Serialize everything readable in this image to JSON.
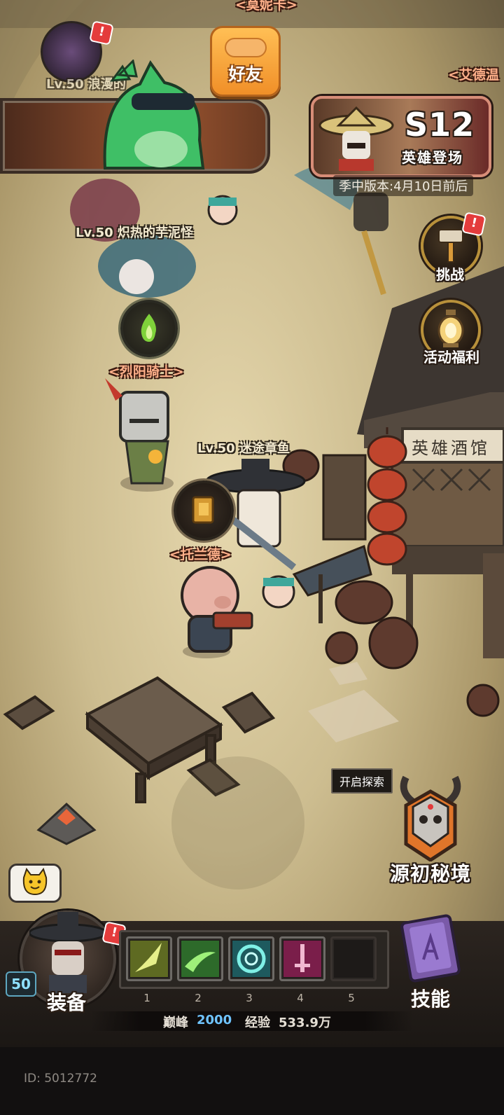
{
  "friends_button": {
    "label": "好友"
  },
  "season_banner": {
    "season": "S12",
    "subtitle": "英雄登场",
    "note": "季中版本:4月10日前后"
  },
  "side_buttons": [
    {
      "label": "挑战",
      "icon": "hammer-icon"
    },
    {
      "label": "活动福利",
      "icon": "lantern-icon"
    }
  ],
  "players": [
    {
      "name": "Lv.50 浪漫的"
    },
    {
      "name": "Lv.50 炽热的芋泥怪"
    },
    {
      "name": "Lv.50 迷途章鱼"
    }
  ],
  "npcs": [
    {
      "name": "<烈阳骑士>"
    },
    {
      "name": "<托兰德>"
    },
    {
      "name": "<艾德温"
    },
    {
      "name": "<莫妮卡>"
    }
  ],
  "tavern_sign": "英雄酒馆",
  "explore": {
    "tip": "开启探索",
    "label": "源初秘境"
  },
  "hud": {
    "level": "50",
    "equip_label": "装备",
    "skill_label": "技能",
    "slot_numbers": [
      "1",
      "2",
      "3",
      "4",
      "5"
    ],
    "peak_label": "巅峰",
    "peak_value": "2000",
    "exp_label": "经验",
    "exp_value": "533.9万",
    "player_id": "ID: 5012772"
  },
  "badge_mark": "!",
  "colors": {
    "accent_orange": "#f7a23a",
    "npc_label": "#ffb08a",
    "badge_red": "#e43c3c",
    "peak_blue": "#6fc4ff"
  }
}
